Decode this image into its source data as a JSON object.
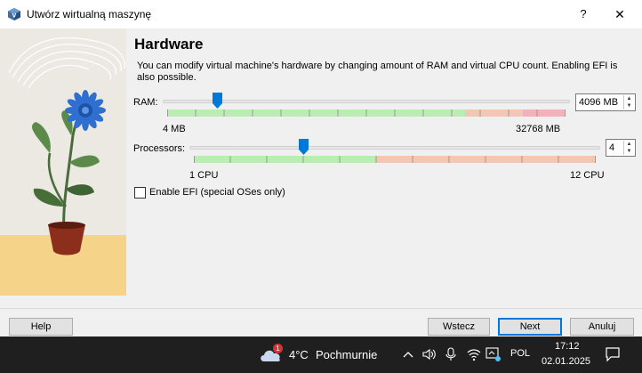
{
  "window": {
    "title": "Utwórz wirtualną maszynę",
    "help_glyph": "?",
    "close_glyph": "✕"
  },
  "page": {
    "heading": "Hardware",
    "description": "You can modify virtual machine's hardware by changing amount of RAM and virtual CPU count. Enabling EFI is also possible."
  },
  "ram": {
    "label": "RAM:",
    "min_label": "4 MB",
    "max_label": "32768 MB",
    "value": "4096 MB"
  },
  "processors": {
    "label": "Processors:",
    "min_label": "1 CPU",
    "max_label": "12 CPU",
    "value": "4"
  },
  "efi": {
    "label": "Enable EFI (special OSes only)",
    "checked": false
  },
  "buttons": {
    "help": "Help",
    "back": "Wstecz",
    "next": "Next",
    "cancel": "Anuluj"
  },
  "taskbar": {
    "weather_badge": "1",
    "temperature": "4°C",
    "weather": "Pochmurnie",
    "language": "POL",
    "time": "17:12",
    "date": "02.01.2025"
  },
  "colors": {
    "green_zone": "#b8eeaf",
    "orange_zone": "#f5c6b1",
    "red_zone": "#f2b2b9",
    "accent": "#0078d7",
    "taskbar_bg": "#1f1f1f"
  }
}
